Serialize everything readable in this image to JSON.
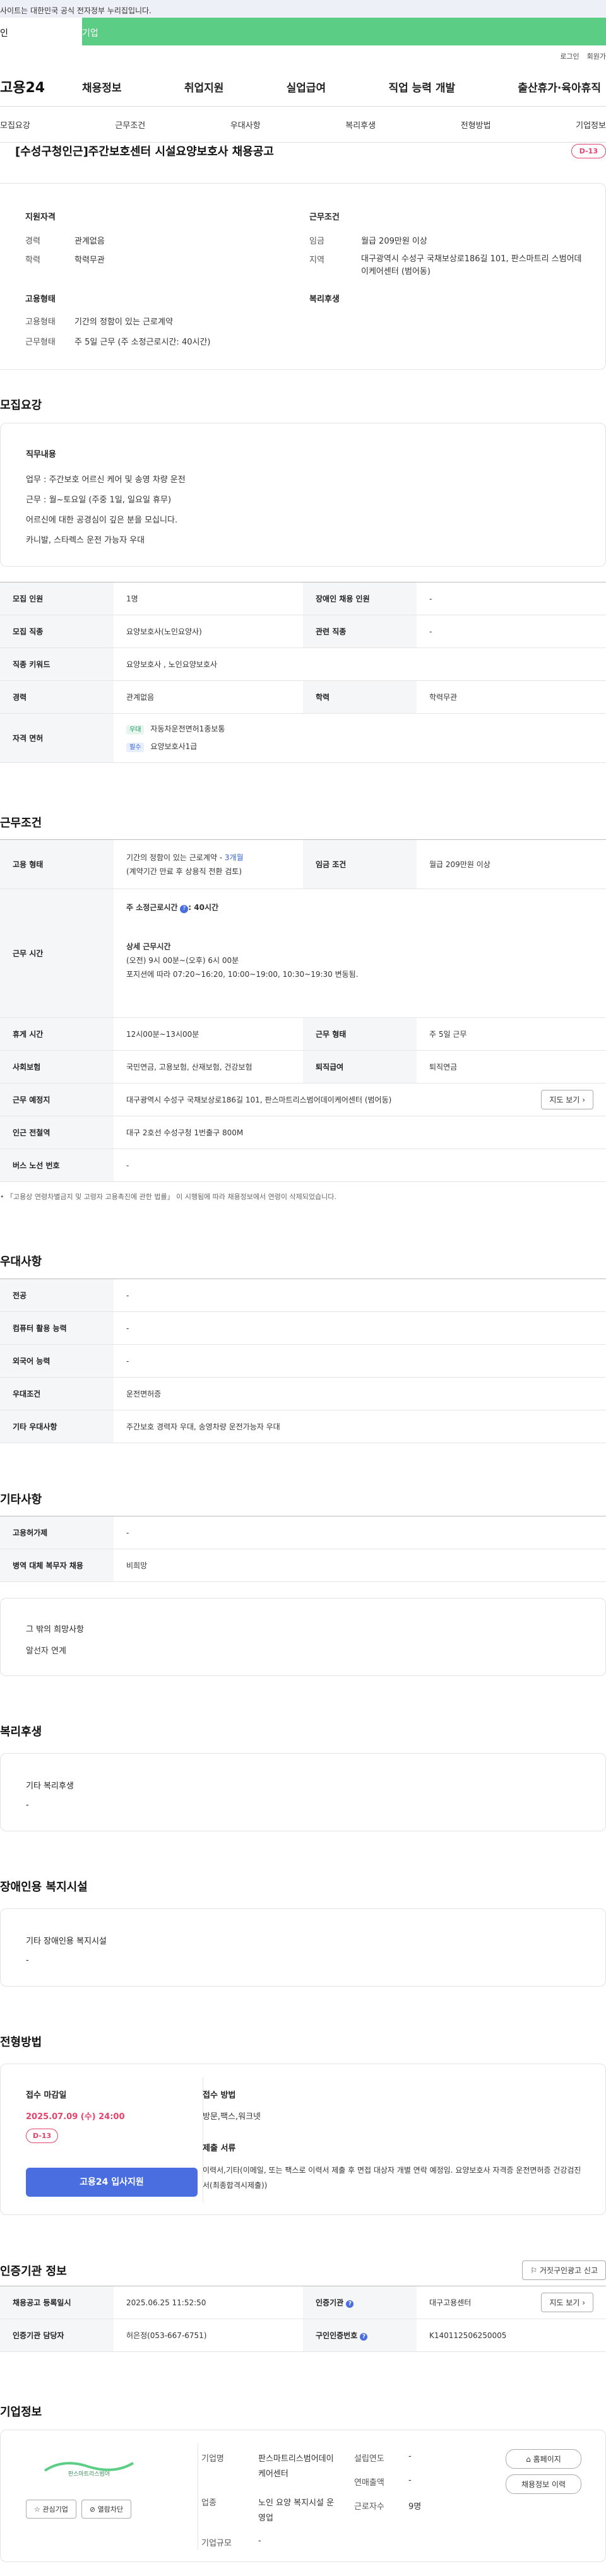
{
  "gov_notice": "사이트는 대한민국 공식 전자정부 누리집입니다.",
  "tabs": {
    "individual": "인",
    "enterprise": "기업"
  },
  "util": {
    "login": "로그인",
    "join": "회원가"
  },
  "logo": "고용24",
  "gnb": [
    "채용정보",
    "취업지원",
    "실업급여",
    "직업 능력 개발",
    "출산휴가·육아휴직"
  ],
  "snb": [
    "모집요강",
    "근무조건",
    "우대사항",
    "복리후생",
    "전형방법",
    "기업정보"
  ],
  "job": {
    "title": "[수성구청인근]주간보호센터 시설요양보호사 채용공고",
    "dday": "D-13",
    "qualification_title": "지원자격",
    "career_label": "경력",
    "career": "관계없음",
    "education_label": "학력",
    "education": "학력무관",
    "conditions_title": "근무조건",
    "wage_label": "임금",
    "wage": "월급 209만원 이상",
    "region_label": "지역",
    "region": "대구광역시 수성구 국채보상로186길 101, 판스마트리 스범어데이케어센터 (범어동)",
    "employment_title": "고용형태",
    "emp_type_label": "고용형태",
    "emp_type": "기간의 정함이 있는 근로계약",
    "work_type_label": "근무형태",
    "work_type": "주 5일 근무 (주 소정근로시간: 40시간)",
    "welfare_title": "복리후생"
  },
  "recruit": {
    "section_title": "모집요강",
    "duty_title": "직무내용",
    "duty_lines": [
      "업무 : 주간보호 어르신 케어 및 송영 차량 운전",
      "근무 : 월~토요일 (주중 1일, 일요일 휴무)",
      "어르신에 대한 공경심이 깊은 분을 모십니다.",
      " 카니발, 스타렉스 운전 가능자 우대"
    ],
    "rows": {
      "headcount_label": "모집 인원",
      "headcount": "1명",
      "disabled_label": "장애인 채용 인원",
      "disabled": "-",
      "job_label": "모집 직종",
      "job": "요양보호사(노인요양사)",
      "related_label": "관련 직종",
      "related": "-",
      "keyword_label": "직종 키워드",
      "keyword": "요양보호사 , 노인요양보호사",
      "career_label": "경력",
      "career": "관계없음",
      "edu_label": "학력",
      "edu": "학력무관",
      "license_label": "자격 면허",
      "license_items": [
        {
          "tag": "우대",
          "name": "자동차운전면허1종보통"
        },
        {
          "tag": "필수",
          "name": "요양보호사1급"
        }
      ]
    }
  },
  "work": {
    "section_title": "근무조건",
    "emp_label": "고용 형태",
    "emp_line1": "기간의 정함이 있는 근로계약 - ",
    "emp_months": "3개월",
    "emp_line2": "(계약기간 만료 후 상용직 전환 검토)",
    "wage_label": "임금 조건",
    "wage": "월급 209만원 이상",
    "hours_label": "근무 시간",
    "hours_title": "주 소정근로시간",
    "hours_value": ": 40시간",
    "detail_title": "상세 근무시간",
    "detail_line1": "(오전) 9시 00분~(오후) 6시 00분",
    "detail_line2": "포지션에 따라 07:20~16:20, 10:00~19:00, 10:30~19:30 변동됨.",
    "break_label": "휴게 시간",
    "break": "12시00분~13시00분",
    "form_label": "근무 형태",
    "form": "주 5일 근무",
    "insurance_label": "사회보험",
    "insurance": "국민연금, 고용보험, 산재보험, 건강보험",
    "retire_label": "퇴직급여",
    "retire": "퇴직연금",
    "place_label": "근무 예정지",
    "place": "대구광역시 수성구 국채보상로186길 101, 판스마트리스범어데이케어센터 (범어동)",
    "map_button": "지도 보기",
    "subway_label": "인근 전철역",
    "subway": "대구 2호선 수성구청 1번출구 800M",
    "bus_label": "버스 노선 번호",
    "bus": "-",
    "note": "「고용상 연령차별금지 및 고령자 고용촉진에 관한 법률」 이 시행됨에 따라 채용정보에서 연령이 삭제되었습니다."
  },
  "prefer": {
    "section_title": "우대사항",
    "major_label": "전공",
    "major": "-",
    "computer_label": "컴퓨터 활용 능력",
    "computer": "-",
    "language_label": "외국어 능력",
    "language": "-",
    "condition_label": "우대조건",
    "condition": "운전면허증",
    "etc_label": "기타 우대사항",
    "etc": "주간보호 경력자 우대, 송영차량 운전가능자 우대"
  },
  "etc": {
    "section_title": "기타사항",
    "insurance_label": "고용허가제",
    "insurance": "-",
    "military_label": "병역 대체 복무자 채용",
    "military": "비희망",
    "other_title": "그 밖의 희망사항",
    "other": "알선자 연계"
  },
  "welfare": {
    "section_title": "복리후생",
    "box_title": "기타 복리후생",
    "box_value": "-"
  },
  "disabled_facility": {
    "section_title": "장애인용 복지시설",
    "box_title": "기타 장애인용 복지시설",
    "box_value": "-"
  },
  "selection": {
    "section_title": "전형방법",
    "deadline_title": "접수 마감일",
    "deadline": "2025.07.09 (수) 24:00",
    "dday": "D-13",
    "apply_button": "고용24 입사지원",
    "method_title": "접수 방법",
    "method": "방문,팩스,워크넷",
    "docs_title": "제출 서류",
    "docs": "이력서,기타(이메일, 또는 팩스로 이력서 제출 후 면접 대상자 개별 연락 예정임. 요양보호사 자격증 운전면허증 건강검진서(최종합격시제출))"
  },
  "cert": {
    "section_title": "인증기관 정보",
    "report_button": "거짓구인광고 신고",
    "reg_date_label": "채용공고 등록일시",
    "reg_date": "2025.06.25 11:52:50",
    "agency_label": "인증기관",
    "agency": "대구고용센터",
    "manager_label": "인증기관 담당자",
    "manager": "허은정(053-667-6751)",
    "number_label": "구인인증번호",
    "number": "K140112506250005",
    "map_button": "지도 보기"
  },
  "company": {
    "section_title": "기업정보",
    "logo_text": "판스마트리스범어",
    "fav_button": "관심기업",
    "block_button": "열람차단",
    "name_label": "기업명",
    "name": "판스마트리스범어데이케어센터",
    "founded_label": "설립연도",
    "founded": "-",
    "industry_label": "업종",
    "industry": "노인 요양 복지시설 운영업",
    "revenue_label": "연매출액",
    "revenue": "-",
    "size_label": "기업규모",
    "size": "-",
    "employees_label": "근로자수",
    "employees": "9명",
    "homepage_button": "홈페이지",
    "history_button": "채용정보 이력"
  }
}
